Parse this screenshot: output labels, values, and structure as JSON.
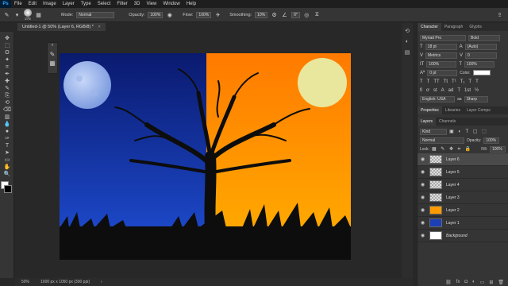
{
  "menu": {
    "logo": "Ps",
    "items": [
      "File",
      "Edit",
      "Image",
      "Layer",
      "Type",
      "Select",
      "Filter",
      "3D",
      "View",
      "Window",
      "Help"
    ]
  },
  "options": {
    "brush_size": "275",
    "mode_label": "Mode:",
    "mode_value": "Normal",
    "opacity_label": "Opacity:",
    "opacity_value": "100%",
    "flow_label": "Flow:",
    "flow_value": "100%",
    "smoothing_label": "Smoothing:",
    "smoothing_value": "10%",
    "angle_value": "0°"
  },
  "document": {
    "tab_title": "Untitled-1 @ 50% (Layer 6, RGB/8) *"
  },
  "status": {
    "zoom": "50%",
    "doc_info": "1000 px x 1050 px (300 ppi)"
  },
  "character_panel": {
    "tabs": [
      "Character",
      "Paragraph",
      "Glyphs"
    ],
    "font_family": "Myriad Pro",
    "font_style": "Bold",
    "size": "18 pt",
    "leading": "(Auto)",
    "kerning": "Metrics",
    "tracking": "0",
    "vscale": "100%",
    "hscale": "100%",
    "baseline": "0 pt",
    "color_label": "Color:",
    "language": "English: USA",
    "antialias": "Sharp"
  },
  "properties_tabs": [
    "Properties",
    "Libraries",
    "Layer Comps"
  ],
  "layers_panel": {
    "tabs": [
      "Layers",
      "Channels"
    ],
    "kind": "Kind",
    "blend_mode": "Normal",
    "opacity_label": "Opacity:",
    "opacity_value": "100%",
    "lock_label": "Lock:",
    "fill_label": "Fill:",
    "fill_value": "100%",
    "layers": [
      {
        "name": "Layer 6",
        "thumb": "checker",
        "selected": true
      },
      {
        "name": "Layer 5",
        "thumb": "checker",
        "selected": false
      },
      {
        "name": "Layer 4",
        "thumb": "checker",
        "selected": false
      },
      {
        "name": "Layer 3",
        "thumb": "checker",
        "selected": false
      },
      {
        "name": "Layer 2",
        "thumb": "orange",
        "selected": false
      },
      {
        "name": "Layer 1",
        "thumb": "blue",
        "selected": false
      },
      {
        "name": "Background",
        "thumb": "white",
        "selected": false
      }
    ]
  },
  "colors": {
    "night_top": "#0a1a6e",
    "night_bottom": "#1f4fd6",
    "day_top": "#ff7a00",
    "day_bottom": "#ffb000",
    "sun": "#e9e79e",
    "ground": "#0d0d0d"
  },
  "icons": {
    "eye": "eye-icon",
    "tools": [
      "move-tool-icon",
      "marquee-tool-icon",
      "lasso-tool-icon",
      "quick-select-tool-icon",
      "crop-tool-icon",
      "eyedropper-tool-icon",
      "healing-brush-icon",
      "brush-tool-icon",
      "clone-stamp-icon",
      "history-brush-icon",
      "eraser-tool-icon",
      "gradient-tool-icon",
      "blur-tool-icon",
      "dodge-tool-icon",
      "pen-tool-icon",
      "type-tool-icon",
      "path-select-icon",
      "rectangle-tool-icon",
      "hand-tool-icon",
      "zoom-tool-icon"
    ]
  }
}
